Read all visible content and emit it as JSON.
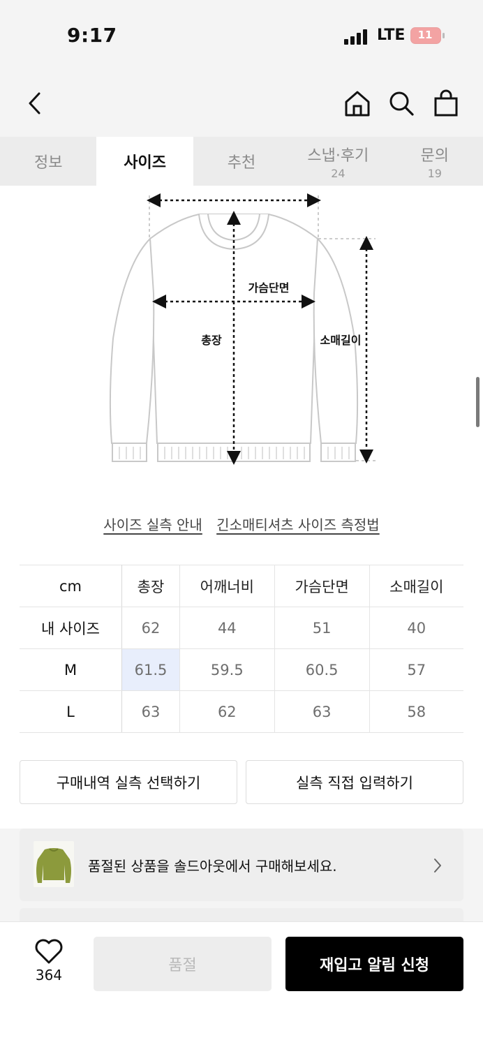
{
  "status": {
    "time": "9:17",
    "network": "LTE",
    "battery": "11"
  },
  "tabs": [
    {
      "label": "정보",
      "count": ""
    },
    {
      "label": "사이즈",
      "count": ""
    },
    {
      "label": "추천",
      "count": ""
    },
    {
      "label": "스냅·후기",
      "count": "24"
    },
    {
      "label": "문의",
      "count": "19"
    }
  ],
  "diagram": {
    "chest": "가슴단면",
    "length": "총장",
    "sleeve": "소매길이"
  },
  "links": {
    "size_guide": "사이즈 실측 안내",
    "measure_method": "긴소매티셔츠 사이즈 측정법"
  },
  "size_table": {
    "headers": [
      "cm",
      "총장",
      "어깨너비",
      "가슴단면",
      "소매길이"
    ],
    "rows": [
      [
        "내 사이즈",
        "62",
        "44",
        "51",
        "40"
      ],
      [
        "M",
        "61.5",
        "59.5",
        "60.5",
        "57"
      ],
      [
        "L",
        "63",
        "62",
        "63",
        "58"
      ]
    ]
  },
  "buttons": {
    "select_purchase": "구매내역 실측 선택하기",
    "direct_input": "실측 직접 입력하기"
  },
  "promo": {
    "text": "품절된 상품을 솔드아웃에서 구매해보세요."
  },
  "bottom": {
    "likes": "364",
    "soldout": "품절",
    "notify": "재입고 알림 신청"
  },
  "icons": [
    "back-icon",
    "home-icon",
    "search-icon",
    "shopping-bag-icon",
    "heart-icon",
    "chevron-right-icon"
  ]
}
